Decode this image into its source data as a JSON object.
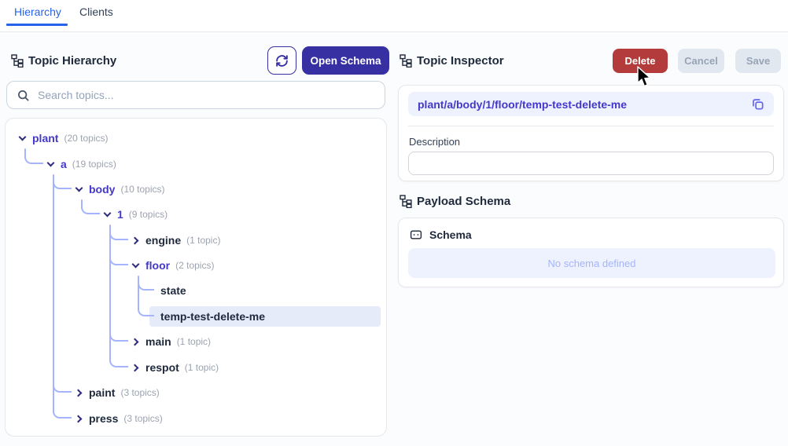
{
  "tabs": {
    "hierarchy": "Hierarchy",
    "clients": "Clients"
  },
  "colors": {
    "accent_blue": "#2563eb",
    "primary_indigo": "#3730a3",
    "expanded_node": "#4338ca",
    "connector": "#a5b4fc",
    "delete_red": "#b33b3b",
    "selection_bg": "#e6ebfa",
    "field_bg": "#eef2ff"
  },
  "left_panel": {
    "title": "Topic Hierarchy",
    "refresh_icon": "refresh-icon",
    "open_schema_label": "Open Schema",
    "search": {
      "placeholder": "Search topics...",
      "value": ""
    },
    "tree": {
      "rows": [
        {
          "label": "plant",
          "count": "(20 topics)",
          "depth": 0,
          "state": "expanded"
        },
        {
          "label": "a",
          "count": "(19 topics)",
          "depth": 1,
          "state": "expanded"
        },
        {
          "label": "body",
          "count": "(10 topics)",
          "depth": 2,
          "state": "expanded"
        },
        {
          "label": "1",
          "count": "(9 topics)",
          "depth": 3,
          "state": "expanded"
        },
        {
          "label": "engine",
          "count": "(1 topic)",
          "depth": 4,
          "state": "collapsed"
        },
        {
          "label": "floor",
          "count": "(2 topics)",
          "depth": 4,
          "state": "expanded"
        },
        {
          "label": "state",
          "count": "",
          "depth": 5,
          "state": "leaf"
        },
        {
          "label": "temp-test-delete-me",
          "count": "",
          "depth": 5,
          "state": "leaf",
          "selected": true
        },
        {
          "label": "main",
          "count": "(1 topic)",
          "depth": 4,
          "state": "collapsed"
        },
        {
          "label": "respot",
          "count": "(1 topic)",
          "depth": 4,
          "state": "collapsed"
        },
        {
          "label": "paint",
          "count": "(3 topics)",
          "depth": 2,
          "state": "collapsed"
        },
        {
          "label": "press",
          "count": "(3 topics)",
          "depth": 2,
          "state": "collapsed"
        }
      ]
    }
  },
  "right_panel": {
    "title": "Topic Inspector",
    "delete_label": "Delete",
    "cancel_label": "Cancel",
    "save_label": "Save",
    "topic_path": "plant/a/body/1/floor/temp-test-delete-me",
    "copy_icon": "copy-icon",
    "description_label": "Description",
    "description_value": "",
    "payload_schema_title": "Payload Schema",
    "schema_label": "Schema",
    "no_schema_text": "No schema defined"
  }
}
